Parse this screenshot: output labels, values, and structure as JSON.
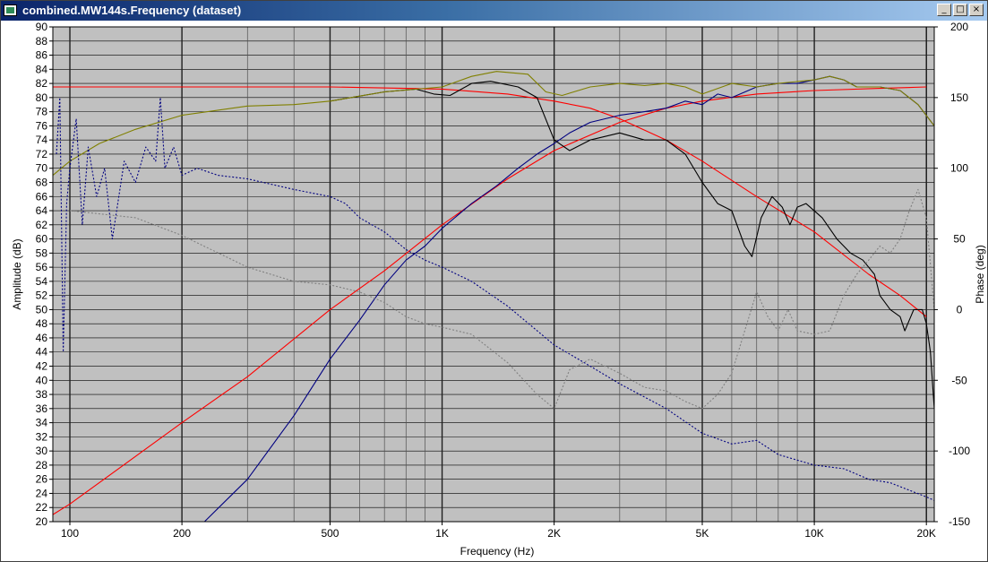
{
  "window": {
    "title": "combined.MW144s.Frequency (dataset)",
    "minimize_glyph": "_",
    "maximize_glyph": "□",
    "close_glyph": "×"
  },
  "chart_data": {
    "type": "line",
    "xlabel": "Frequency (Hz)",
    "ylabel": "Amplitude (dB)",
    "y2label": "Phase (deg)",
    "x_scale": "log",
    "xlim": [
      90,
      21000
    ],
    "ylim": [
      20,
      90
    ],
    "y2lim": [
      -150,
      200
    ],
    "grid": true,
    "background": "#c0c0c0",
    "x_ticks": [
      {
        "value": 100,
        "label": "100"
      },
      {
        "value": 200,
        "label": "200"
      },
      {
        "value": 500,
        "label": "500"
      },
      {
        "value": 1000,
        "label": "1K"
      },
      {
        "value": 2000,
        "label": "2K"
      },
      {
        "value": 5000,
        "label": "5K"
      },
      {
        "value": 10000,
        "label": "10K"
      },
      {
        "value": 20000,
        "label": "20K"
      }
    ],
    "y_ticks": [
      20,
      22,
      24,
      26,
      28,
      30,
      32,
      34,
      36,
      38,
      40,
      42,
      44,
      46,
      48,
      50,
      52,
      54,
      56,
      58,
      60,
      62,
      64,
      66,
      68,
      70,
      72,
      74,
      76,
      78,
      80,
      82,
      84,
      86,
      88,
      90
    ],
    "y2_ticks": [
      -150,
      -100,
      -50,
      0,
      50,
      100,
      150,
      200
    ],
    "series": [
      {
        "color": "#ff0000",
        "style": "solid",
        "axis": "left",
        "points": [
          [
            90,
            21
          ],
          [
            100,
            22.5
          ],
          [
            200,
            34
          ],
          [
            300,
            40.5
          ],
          [
            500,
            50
          ],
          [
            700,
            55.5
          ],
          [
            1000,
            62
          ],
          [
            1500,
            68.5
          ],
          [
            2000,
            72.5
          ],
          [
            3000,
            76.5
          ],
          [
            4000,
            78.5
          ],
          [
            5000,
            79.5
          ],
          [
            7000,
            80.5
          ],
          [
            10000,
            81
          ],
          [
            15000,
            81.3
          ],
          [
            20000,
            81.5
          ]
        ]
      },
      {
        "color": "#ff0000",
        "style": "solid",
        "axis": "left",
        "points": [
          [
            90,
            81.5
          ],
          [
            200,
            81.5
          ],
          [
            500,
            81.5
          ],
          [
            800,
            81.3
          ],
          [
            1000,
            81.2
          ],
          [
            1500,
            80.5
          ],
          [
            2000,
            79.5
          ],
          [
            2500,
            78.5
          ],
          [
            3000,
            77
          ],
          [
            4000,
            74
          ],
          [
            5000,
            71
          ],
          [
            7000,
            66
          ],
          [
            10000,
            61
          ],
          [
            14000,
            55
          ],
          [
            17000,
            52
          ],
          [
            20000,
            49
          ]
        ]
      },
      {
        "color": "#000080",
        "style": "solid",
        "axis": "left",
        "points": [
          [
            230,
            20
          ],
          [
            300,
            26
          ],
          [
            400,
            35
          ],
          [
            500,
            43
          ],
          [
            600,
            48.5
          ],
          [
            700,
            53.5
          ],
          [
            800,
            57
          ],
          [
            900,
            59
          ],
          [
            1000,
            61.5
          ],
          [
            1200,
            65
          ],
          [
            1400,
            67.5
          ],
          [
            1600,
            70
          ],
          [
            1800,
            72
          ],
          [
            2000,
            73.5
          ],
          [
            2200,
            75
          ],
          [
            2500,
            76.5
          ],
          [
            3000,
            77.5
          ],
          [
            3500,
            78
          ],
          [
            4000,
            78.5
          ],
          [
            4500,
            79.5
          ],
          [
            5000,
            79
          ],
          [
            5500,
            80.5
          ],
          [
            6000,
            80
          ],
          [
            7000,
            81.5
          ],
          [
            8000,
            82
          ],
          [
            9000,
            82
          ],
          [
            10000,
            82.5
          ],
          [
            11000,
            83
          ],
          [
            12000,
            82.5
          ],
          [
            13000,
            81.5
          ],
          [
            15000,
            81.5
          ],
          [
            17000,
            81
          ],
          [
            19000,
            79
          ],
          [
            21000,
            76
          ]
        ]
      },
      {
        "color": "#000000",
        "style": "solid",
        "axis": "left",
        "points": [
          [
            500,
            79.5
          ],
          [
            700,
            80.8
          ],
          [
            850,
            81.2
          ],
          [
            950,
            80.5
          ],
          [
            1050,
            80.3
          ],
          [
            1200,
            82
          ],
          [
            1350,
            82.3
          ],
          [
            1600,
            81.5
          ],
          [
            1800,
            80
          ],
          [
            2000,
            74
          ],
          [
            2200,
            72.5
          ],
          [
            2500,
            74
          ],
          [
            3000,
            75
          ],
          [
            3500,
            74
          ],
          [
            4000,
            74
          ],
          [
            4500,
            72
          ],
          [
            5000,
            68
          ],
          [
            5500,
            65
          ],
          [
            6000,
            64
          ],
          [
            6500,
            59
          ],
          [
            6800,
            57.5
          ],
          [
            7200,
            63
          ],
          [
            7700,
            66
          ],
          [
            8200,
            64.5
          ],
          [
            8600,
            62
          ],
          [
            9000,
            64.5
          ],
          [
            9500,
            65
          ],
          [
            10500,
            63
          ],
          [
            11500,
            60
          ],
          [
            12500,
            58
          ],
          [
            13500,
            57
          ],
          [
            14500,
            55
          ],
          [
            15000,
            52
          ],
          [
            16000,
            50
          ],
          [
            17000,
            49
          ],
          [
            17500,
            47
          ],
          [
            18500,
            50
          ],
          [
            19500,
            50
          ],
          [
            20000,
            48
          ],
          [
            20500,
            44
          ],
          [
            21000,
            36
          ]
        ]
      },
      {
        "color": "#808000",
        "style": "solid",
        "axis": "left",
        "points": [
          [
            90,
            69
          ],
          [
            100,
            71
          ],
          [
            120,
            73.5
          ],
          [
            150,
            75.5
          ],
          [
            200,
            77.5
          ],
          [
            300,
            78.8
          ],
          [
            400,
            79
          ],
          [
            500,
            79.5
          ],
          [
            700,
            80.8
          ],
          [
            1000,
            81.5
          ],
          [
            1200,
            83
          ],
          [
            1400,
            83.7
          ],
          [
            1700,
            83.3
          ],
          [
            1900,
            80.8
          ],
          [
            2100,
            80.3
          ],
          [
            2500,
            81.5
          ],
          [
            3000,
            82
          ],
          [
            3500,
            81.7
          ],
          [
            4000,
            82
          ],
          [
            4500,
            81.5
          ],
          [
            5000,
            80.5
          ],
          [
            6000,
            82
          ],
          [
            7000,
            81.5
          ],
          [
            8000,
            82
          ],
          [
            10000,
            82.5
          ],
          [
            11000,
            83
          ],
          [
            12000,
            82.5
          ],
          [
            13000,
            81.5
          ],
          [
            15000,
            81.5
          ],
          [
            17000,
            81
          ],
          [
            19000,
            79
          ],
          [
            21000,
            76
          ]
        ]
      },
      {
        "color": "#000080",
        "style": "dashed",
        "axis": "left",
        "points": [
          [
            92,
            72
          ],
          [
            94,
            80
          ],
          [
            96,
            44
          ],
          [
            98,
            65
          ],
          [
            100,
            70
          ],
          [
            104,
            77
          ],
          [
            108,
            62
          ],
          [
            112,
            73
          ],
          [
            118,
            66
          ],
          [
            124,
            70
          ],
          [
            130,
            60
          ],
          [
            140,
            71
          ],
          [
            150,
            68
          ],
          [
            160,
            73
          ],
          [
            170,
            71
          ],
          [
            175,
            80
          ],
          [
            180,
            70
          ],
          [
            190,
            73
          ],
          [
            200,
            69
          ],
          [
            220,
            70
          ],
          [
            250,
            69
          ],
          [
            300,
            68.5
          ],
          [
            400,
            67
          ],
          [
            500,
            66
          ],
          [
            550,
            65
          ],
          [
            600,
            63
          ],
          [
            700,
            61
          ],
          [
            800,
            58.5
          ],
          [
            900,
            57
          ],
          [
            1000,
            56
          ],
          [
            1200,
            54
          ],
          [
            1500,
            50.5
          ],
          [
            2000,
            45
          ],
          [
            2500,
            42
          ],
          [
            3000,
            39.5
          ],
          [
            4000,
            36
          ],
          [
            5000,
            32.5
          ],
          [
            6000,
            31
          ],
          [
            7000,
            31.5
          ],
          [
            8000,
            29.5
          ],
          [
            10000,
            28
          ],
          [
            12000,
            27.5
          ],
          [
            14000,
            26
          ],
          [
            16000,
            25.5
          ],
          [
            20000,
            23.5
          ],
          [
            21000,
            23
          ]
        ]
      },
      {
        "color": "#808080",
        "style": "dashed",
        "axis": "left",
        "points": [
          [
            100,
            64
          ],
          [
            150,
            63
          ],
          [
            200,
            60.5
          ],
          [
            300,
            56
          ],
          [
            400,
            54
          ],
          [
            500,
            53.5
          ],
          [
            600,
            52.5
          ],
          [
            700,
            51
          ],
          [
            800,
            49
          ],
          [
            900,
            48
          ],
          [
            1000,
            47.5
          ],
          [
            1200,
            46.5
          ],
          [
            1500,
            42.5
          ],
          [
            1800,
            38
          ],
          [
            2000,
            36
          ],
          [
            2200,
            41.5
          ],
          [
            2500,
            43
          ],
          [
            3000,
            41
          ],
          [
            3500,
            39
          ],
          [
            4000,
            38.5
          ],
          [
            4500,
            37
          ],
          [
            5000,
            36
          ],
          [
            5500,
            38
          ],
          [
            6000,
            41
          ],
          [
            6500,
            47
          ],
          [
            7000,
            52.5
          ],
          [
            7500,
            49
          ],
          [
            8000,
            47
          ],
          [
            8500,
            50
          ],
          [
            9000,
            47
          ],
          [
            10000,
            46.5
          ],
          [
            11000,
            47
          ],
          [
            12000,
            52
          ],
          [
            13000,
            55
          ],
          [
            14000,
            57
          ],
          [
            15000,
            59
          ],
          [
            16000,
            58
          ],
          [
            17000,
            60
          ],
          [
            18000,
            64
          ],
          [
            19000,
            67
          ],
          [
            20000,
            63
          ],
          [
            21000,
            50
          ]
        ]
      }
    ]
  }
}
